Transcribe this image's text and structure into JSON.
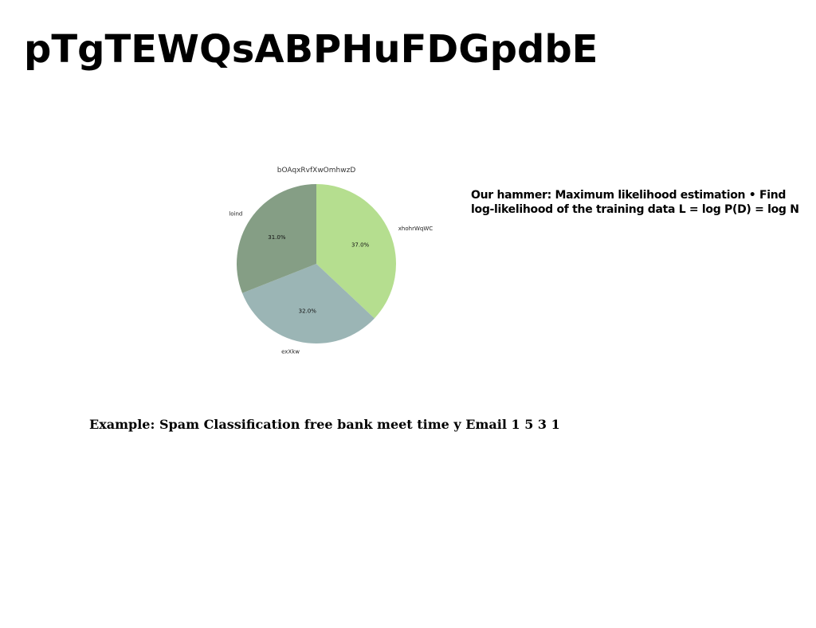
{
  "slide": {
    "title": "pTgTEWQsABPHuFDGpdbE",
    "side_text_lines": [
      "Our hammer: Maximum likelihood estimation • Find",
      "log-likelihood of the training data L = log P(D) = log N"
    ],
    "example_text": "Example: Spam Classification free bank meet time y Email 1 5 3 1"
  },
  "chart_data": {
    "type": "pie",
    "title": "bOAqxRvfXwOmhwzD",
    "categories": [
      "xhohrWqWC",
      "exXkw",
      "loind"
    ],
    "values": [
      37.0,
      32.0,
      31.0
    ],
    "value_labels": [
      "37.0%",
      "32.0%",
      "31.0%"
    ],
    "colors": [
      "#b5de8f",
      "#9bb5b5",
      "#859e85"
    ],
    "start_angle_deg": 90,
    "direction": "clockwise"
  }
}
